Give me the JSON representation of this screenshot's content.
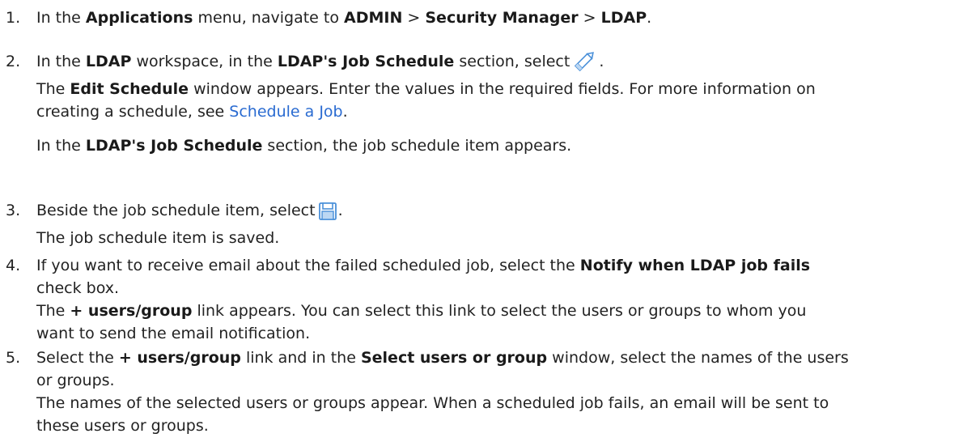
{
  "steps": [
    {
      "number": "1.",
      "lines": [
        {
          "t1": "In the ",
          "b1": "Applications",
          "t2": " menu, navigate to ",
          "b2": "ADMIN",
          "t3": " > ",
          "b3": "Security Manager",
          "t4": " > ",
          "b4": "LDAP",
          "t5": "."
        }
      ]
    },
    {
      "number": "2.",
      "line1": {
        "t1": "In the ",
        "b1": "LDAP",
        "t2": " workspace, in the ",
        "b2": "LDAP's Job Schedule",
        "t3": " section, select",
        "t4": "."
      },
      "line2": {
        "t1": "The ",
        "b1": "Edit Schedule",
        "t2": " window appears. Enter the values in the required fields. For more information on"
      },
      "line3": {
        "t1": "creating a schedule, see ",
        "link": "Schedule a Job",
        "t2": "."
      },
      "line4": {
        "t1": "In the ",
        "b1": "LDAP's Job Schedule",
        "t2": " section, the job schedule item appears."
      },
      "icon": "pencil-icon"
    },
    {
      "number": "3.",
      "line1": {
        "t1": "Beside the job schedule item, select",
        "t2": "."
      },
      "line2": {
        "t1": "The job schedule item is saved."
      },
      "icon": "save-icon"
    },
    {
      "number": "4.",
      "line1": {
        "t1": "If you want to receive email about the failed scheduled job, select the ",
        "b1": "Notify when LDAP job fails"
      },
      "line2": {
        "t1": "check box."
      },
      "line3": {
        "t1": "The ",
        "b1": "+ users/group",
        "t2": " link appears. You can select this link to select the users or groups to whom you"
      },
      "line4": {
        "t1": "want to send the email notification."
      }
    },
    {
      "number": "5.",
      "line1": {
        "t1": "Select the ",
        "b1": "+ users/group",
        "t2": " link and in the ",
        "b2": "Select users or group",
        "t3": " window, select the names of the users"
      },
      "line2": {
        "t1": "or groups."
      },
      "line3": {
        "t1": "The names of the selected users or groups appear. When a scheduled job fails, an email will be sent to"
      },
      "line4": {
        "t1": "these users or groups."
      }
    }
  ],
  "colors": {
    "text": "#222222",
    "link": "#2a6bd1",
    "icon": "#4a90d9"
  }
}
